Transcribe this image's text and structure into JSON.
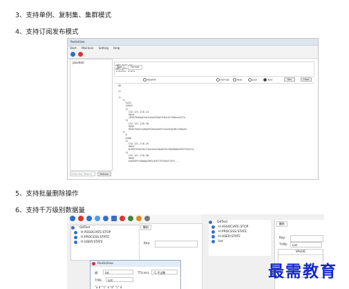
{
  "headings": {
    "h3": "3、支持单例、复制集、集群模式",
    "h4": "4、支持订阅发布模式",
    "h5": "5、支持批量删除操作",
    "h6": "6、支持千万级别数据量"
  },
  "shot1": {
    "window_title": "RedisView",
    "menu": [
      "Start",
      "Maintain",
      "Setting",
      "Help"
    ],
    "tree_root": "pbadbtd",
    "tabs": [
      "Text",
      "Format"
    ],
    "commands": "set rcsr cc.\nget rcsr.\ncluster slots",
    "options": {
      "checkbox": "NoShift",
      "radios": [
        "Format",
        "Raw",
        "Json",
        "Text"
      ],
      "selected": "Text"
    },
    "buttons": {
      "run": "Run",
      "clear": "Clear"
    },
    "output": "OK\n\ncc\n\n1)\n   1)\n     9431\n     10922\n     2)\n       132.121.116.21\n       9095\n       7835f9d6bd7ea41eb4256d753b14f709ea1b27e\n     3)\n       132.121.116.30\n       9095\n       9035f9d5fa26be926eeed2572a4d34e36c286a54\n   2)\n     0\n     5460\n     2)\n       132.121.116.29\n       9095\n       0c839f9d4f61ffbe4eafe8a0154f8e68d6b963f91a2fa\n     3)\n       132.121.116.30\n       9095\n       a4b5d9f4d0daa2081d18715f94bf253f...\n",
    "search_placeholder": "Enter Key Search",
    "refresh_label": "Refresh"
  },
  "shot2": {
    "tree_root": "QdTest",
    "tree_items": [
      "H:ASSOCIATE:STOP",
      "H:PROCESS:STATE",
      "H:USER:STATE"
    ],
    "tab": "解析",
    "key_label": "Key:",
    "dialog": {
      "title": "RedisView",
      "key_label": "键:",
      "key_value": "list",
      "ttl_label": "TTL(ms):",
      "ttl_value": "-1 不过期",
      "type_label": "TYPE:",
      "type_value": "List",
      "list_row": "\"a b\"  \"c\" d  \"d\" \"c\" d"
    },
    "tree2_root": "QdTest",
    "tree2_items": [
      "H:ASSOCIATE:STOP",
      "H:PROCESS:STATE",
      "H:USER:STATE",
      "list"
    ],
    "tab2": "解析",
    "key2_label": "Key:",
    "key2_value": "list",
    "type2_label": "TYPE:",
    "type2_value": "List",
    "value_header": "VALUE"
  },
  "watermark": "最需教育",
  "colors": {
    "watermark": "#1428c8",
    "tree_dot": "#3a6fc4"
  }
}
